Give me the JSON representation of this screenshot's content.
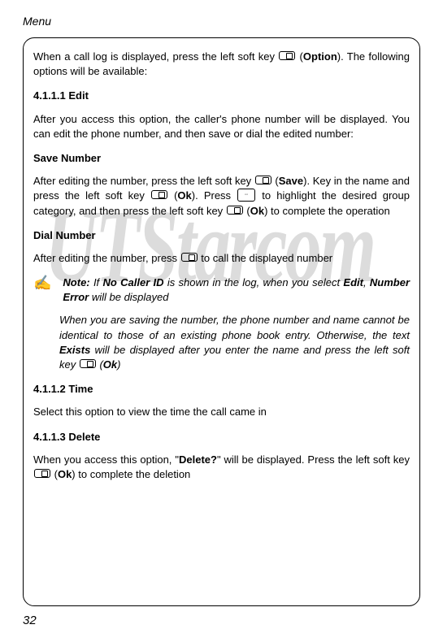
{
  "header": "Menu",
  "pageNumber": "32",
  "watermark": "UTStarcom",
  "intro": {
    "part1": "When a call log is displayed, press the left soft key ",
    "part2": " (",
    "option": "Option",
    "part3": "). The following options will be available:"
  },
  "sec1": {
    "heading": "4.1.1.1 Edit",
    "para": "After you access this option, the caller's phone number will be displayed. You can edit the phone number, and then save or dial the edited number:"
  },
  "saveNumber": {
    "heading": "Save Number",
    "p1": "After editing the number, press the left soft key ",
    "p2": " (",
    "save": "Save",
    "p3": "). Key in the name and press the left soft key ",
    "p4": " (",
    "ok1": "Ok",
    "p5": "). Press ",
    "p6": " to highlight the desired group category, and then press the left soft key ",
    "p7": " (",
    "ok2": "Ok",
    "p8": ") to complete the operation"
  },
  "dialNumber": {
    "heading": "Dial Number",
    "p1": "After editing the number, press ",
    "p2": " to call the displayed number"
  },
  "note": {
    "label": "Note:",
    "p1": " If ",
    "noCaller": "No Caller ID",
    "p2": " is shown in the log, when you select ",
    "edit": "Edit",
    "p3": ", ",
    "numberError": "Number Error",
    "p4": " will be displayed",
    "cont1": "When you are saving the number, the phone number and name cannot be identical to those of an existing phone book entry. Otherwise, the text ",
    "exists": "Exists",
    "cont2": " will be displayed after you enter the name and press the left soft key ",
    "cont3": " (",
    "ok": "Ok",
    "cont4": ")"
  },
  "sec2": {
    "heading": "4.1.1.2 Time",
    "para": "Select this option to view the time the call came in"
  },
  "sec3": {
    "heading": "4.1.1.3 Delete",
    "p1": "When you access this option, \"",
    "delete": "Delete?",
    "p2": "\" will be displayed. Press the left soft key ",
    "p3": " (",
    "ok": "Ok",
    "p4": ") to complete the deletion"
  }
}
